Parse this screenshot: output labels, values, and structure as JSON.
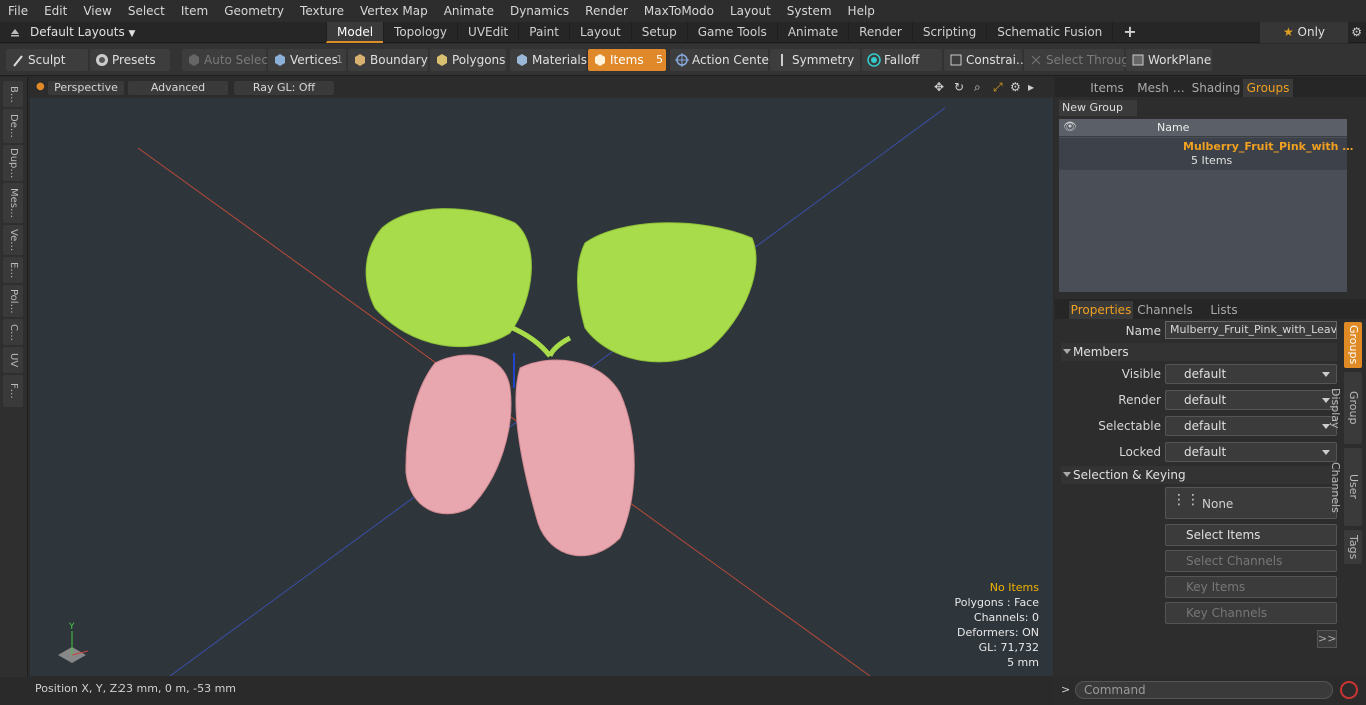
{
  "menu": [
    "File",
    "Edit",
    "View",
    "Select",
    "Item",
    "Geometry",
    "Texture",
    "Vertex Map",
    "Animate",
    "Dynamics",
    "Render",
    "MaxToModo",
    "Layout",
    "System",
    "Help"
  ],
  "layout_bar": {
    "layout_label": "Default Layouts",
    "tabs": [
      "Model",
      "Topology",
      "UVEdit",
      "Paint",
      "Layout",
      "Setup",
      "Game Tools",
      "Animate",
      "Render",
      "Scripting",
      "Schematic Fusion"
    ],
    "active_tab": "Model",
    "only_label": "Only"
  },
  "toolbar": {
    "sculpt": "Sculpt",
    "presets": "Presets",
    "auto_select": "Auto Select",
    "vertices": "Vertices",
    "vertices_count": "1",
    "boundary": "Boundary",
    "polygons": "Polygons",
    "materials": "Materials",
    "items": "Items",
    "items_count": "5",
    "action_center": "Action Center",
    "symmetry": "Symmetry",
    "falloff": "Falloff",
    "constraints": "Constrai…",
    "select_through": "Select Through",
    "workplane": "WorkPlane"
  },
  "left_tabs": [
    "B…",
    "De…",
    "Dup…",
    "Mes…",
    "Ve…",
    "E…",
    "Pol…",
    "C…",
    "UV",
    "F…"
  ],
  "viewport": {
    "perspective": "Perspective",
    "advanced": "Advanced",
    "raygl": "Ray GL: Off",
    "hud": {
      "no_items": "No Items",
      "polygons": "Polygons : Face",
      "channels": "Channels: 0",
      "deformers": "Deformers: ON",
      "gl": "GL: 71,732",
      "scale": "5 mm"
    },
    "colors": {
      "leaf": "#a9dc4b",
      "fruit": "#e8a7ae",
      "background": "#2e353b"
    }
  },
  "status": {
    "position_label": "Position X, Y, Z:",
    "position_value": "23 mm, 0 m, -53 mm"
  },
  "groups_panel": {
    "tabs": [
      "Items",
      "Mesh …",
      "Shading",
      "Groups"
    ],
    "active_tab": "Groups",
    "new_group": "New Group",
    "column_name": "Name",
    "group_name": "Mulberry_Fruit_Pink_with …",
    "group_count": "5 Items"
  },
  "properties_panel": {
    "tabs": [
      "Properties",
      "Channels",
      "Lists"
    ],
    "active_tab": "Properties",
    "name_label": "Name",
    "name_value": "Mulberry_Fruit_Pink_with_Leaves",
    "members_section": "Members",
    "visible_label": "Visible",
    "visible_value": "default",
    "render_label": "Render",
    "render_value": "default",
    "selectable_label": "Selectable",
    "selectable_value": "default",
    "locked_label": "Locked",
    "locked_value": "default",
    "selection_section": "Selection & Keying",
    "none_label": "None",
    "select_items": "Select Items",
    "select_channels": "Select Channels",
    "key_items": "Key Items",
    "key_channels": "Key Channels",
    "more": ">>",
    "side_tabs": [
      "Groups",
      "Group Display",
      "User Channels",
      "Tags"
    ]
  },
  "command": {
    "placeholder": "Command"
  }
}
